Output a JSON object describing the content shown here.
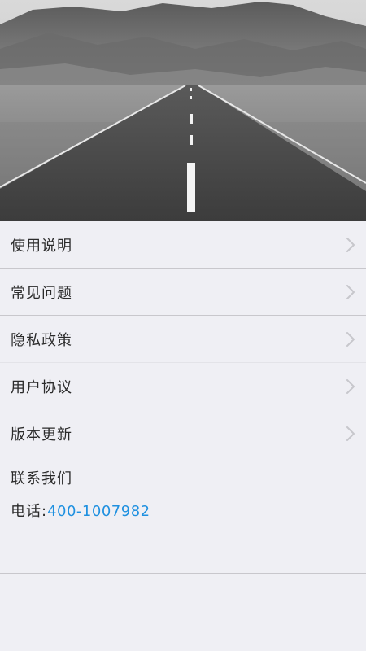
{
  "hero": {
    "image": "mountain-road-photo"
  },
  "menu": {
    "items": [
      {
        "label": "使用说明",
        "icon": "chevron-right-icon"
      },
      {
        "label": "常见问题",
        "icon": "chevron-right-icon"
      },
      {
        "label": "隐私政策",
        "icon": "chevron-right-icon"
      },
      {
        "label": "用户协议",
        "icon": "chevron-right-icon"
      },
      {
        "label": "版本更新",
        "icon": "chevron-right-icon"
      }
    ]
  },
  "contact": {
    "title": "联系我们",
    "phone_label": "电话:",
    "phone_number": "400-1007982"
  },
  "colors": {
    "background": "#efeff4",
    "link": "#1e90e0",
    "divider": "#c8c7cc"
  }
}
